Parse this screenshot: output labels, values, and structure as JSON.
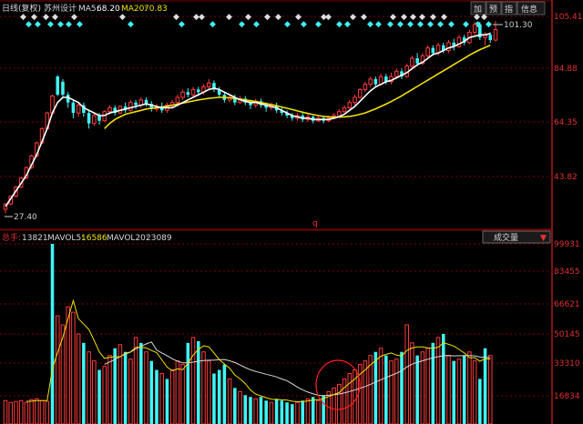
{
  "header": {
    "period": "日线(复权)",
    "stock_name": "苏州设计",
    "ma5_label": "MA5:",
    "ma5_value": "68.20",
    "ma20_label": "MA20:",
    "ma20_value": "70.83",
    "buttons": [
      "加",
      "预",
      "指",
      "信息"
    ]
  },
  "price_axis": {
    "ticks": [
      "105.41",
      "84.88",
      "64.35",
      "43.82"
    ],
    "high_label": "101.30",
    "low_label": "27.40",
    "marker": "q"
  },
  "volume_header": {
    "label": "总手:",
    "value": "13821",
    "mavol5_label": "MAVOL5:",
    "mavol5_value": "16586",
    "mavol20_label": "MAVOL20:",
    "mavol20_value": "23089",
    "indicator": "成交量"
  },
  "volume_axis": {
    "ticks": [
      "99931",
      "83455",
      "66621",
      "50145",
      "33310",
      "16834"
    ]
  },
  "colors": {
    "up": "#ff3b3b",
    "down": "#3ff5f5",
    "ma5": "#ffffff",
    "ma20": "#f0e000",
    "grid": "#7a0000",
    "axis": "#ff2a2a",
    "label_red": "#e03030",
    "circle": "#ff2020"
  },
  "chart_data": {
    "type": "candlestick",
    "title": "苏州设计",
    "price_range": [
      22,
      108
    ],
    "volume_range": [
      0,
      99931
    ],
    "candles": [
      [
        29,
        31,
        27.4,
        31.5,
        "up"
      ],
      [
        31,
        34,
        30.5,
        34.4,
        "up"
      ],
      [
        34,
        37.5,
        33.5,
        38,
        "up"
      ],
      [
        37.5,
        41,
        37,
        41.5,
        "up"
      ],
      [
        41,
        45,
        40.5,
        45.5,
        "up"
      ],
      [
        45,
        49.5,
        44.5,
        50,
        "up"
      ],
      [
        49.5,
        54.5,
        49,
        55,
        "up"
      ],
      [
        54.5,
        60,
        54,
        60.5,
        "up"
      ],
      [
        60,
        66,
        59.5,
        66.5,
        "up"
      ],
      [
        66,
        72.5,
        65.5,
        73,
        "up"
      ],
      [
        73,
        80,
        72.5,
        80.5,
        "down"
      ],
      [
        78,
        73,
        72,
        79,
        "down"
      ],
      [
        73,
        70,
        68,
        74,
        "down"
      ],
      [
        70,
        66,
        64,
        71,
        "down"
      ],
      [
        66,
        69,
        64.5,
        70,
        "up"
      ],
      [
        69,
        66,
        64.5,
        70,
        "down"
      ],
      [
        66,
        62,
        60,
        67,
        "down"
      ],
      [
        62,
        65,
        61,
        66,
        "up"
      ],
      [
        65,
        63,
        61.5,
        66,
        "down"
      ],
      [
        63,
        66.5,
        62.5,
        67,
        "up"
      ],
      [
        66.5,
        68,
        65.5,
        69,
        "up"
      ],
      [
        68,
        66,
        65,
        69,
        "down"
      ],
      [
        66,
        68.5,
        65.5,
        69,
        "up"
      ],
      [
        68.5,
        67,
        66,
        70,
        "down"
      ],
      [
        67,
        70,
        66.5,
        71,
        "up"
      ],
      [
        70,
        69,
        67.5,
        71,
        "down"
      ],
      [
        69,
        71,
        68,
        72,
        "up"
      ],
      [
        71,
        69.5,
        68.5,
        72,
        "down"
      ],
      [
        69.5,
        67.5,
        66.5,
        70.5,
        "down"
      ],
      [
        67.5,
        68.5,
        66.5,
        69.5,
        "up"
      ],
      [
        68.5,
        67,
        66,
        70,
        "down"
      ],
      [
        67,
        69,
        66,
        70,
        "up"
      ],
      [
        69,
        70,
        68,
        71,
        "up"
      ],
      [
        70,
        72,
        69,
        73,
        "up"
      ],
      [
        72,
        74,
        71,
        75,
        "up"
      ],
      [
        74,
        73,
        72,
        75.5,
        "down"
      ],
      [
        73,
        75,
        72,
        76,
        "up"
      ],
      [
        75,
        74,
        72.5,
        76,
        "down"
      ],
      [
        74,
        76,
        73,
        77,
        "up"
      ],
      [
        76,
        77.5,
        75,
        79,
        "up"
      ],
      [
        77.5,
        75,
        74,
        78.5,
        "down"
      ],
      [
        75,
        73,
        72,
        76,
        "down"
      ],
      [
        73,
        71,
        70,
        74,
        "down"
      ],
      [
        71,
        72,
        70,
        73,
        "up"
      ],
      [
        72,
        70,
        69,
        73,
        "down"
      ],
      [
        70,
        71.5,
        69.5,
        72.5,
        "up"
      ],
      [
        71.5,
        70,
        69,
        72.5,
        "down"
      ],
      [
        70,
        69,
        67.5,
        71,
        "down"
      ],
      [
        69,
        70.5,
        68,
        71.5,
        "up"
      ],
      [
        70.5,
        69,
        68,
        71.5,
        "down"
      ],
      [
        69,
        68,
        66.5,
        70,
        "down"
      ],
      [
        68,
        69,
        67,
        70,
        "up"
      ],
      [
        69,
        67,
        66,
        70,
        "down"
      ],
      [
        67,
        66,
        65,
        68,
        "down"
      ],
      [
        66,
        65,
        64,
        67,
        "down"
      ],
      [
        65,
        64,
        63,
        66,
        "down"
      ],
      [
        64,
        65,
        63,
        66,
        "up"
      ],
      [
        65,
        63.5,
        62.5,
        66,
        "down"
      ],
      [
        63.5,
        64.5,
        62.5,
        65.5,
        "up"
      ],
      [
        64.5,
        63,
        62,
        65,
        "down"
      ],
      [
        63,
        64,
        62.5,
        65,
        "up"
      ],
      [
        64,
        63,
        62,
        65,
        "down"
      ],
      [
        63,
        64,
        62.5,
        65,
        "up"
      ],
      [
        64,
        65,
        63.5,
        66,
        "up"
      ],
      [
        65,
        66.5,
        64.5,
        67.5,
        "up"
      ],
      [
        66.5,
        68,
        66,
        69,
        "up"
      ],
      [
        68,
        70,
        67.5,
        71,
        "up"
      ],
      [
        70,
        72,
        69,
        73,
        "up"
      ],
      [
        72,
        75,
        71.5,
        75.5,
        "up"
      ],
      [
        75,
        77,
        74,
        78,
        "up"
      ],
      [
        77,
        79,
        76,
        80,
        "up"
      ],
      [
        79,
        77,
        76,
        80,
        "down"
      ],
      [
        77,
        80,
        76.5,
        81,
        "up"
      ],
      [
        80,
        78,
        77,
        81,
        "down"
      ],
      [
        78,
        80,
        77,
        81.5,
        "up"
      ],
      [
        80,
        82,
        79,
        83,
        "up"
      ],
      [
        82,
        80,
        79,
        83,
        "down"
      ],
      [
        80,
        84,
        79.5,
        85,
        "up"
      ],
      [
        84,
        87,
        83,
        88,
        "up"
      ],
      [
        87,
        85,
        84,
        89,
        "down"
      ],
      [
        85,
        88,
        84.5,
        89,
        "up"
      ],
      [
        88,
        91,
        87,
        92,
        "up"
      ],
      [
        91,
        89,
        88,
        92,
        "down"
      ],
      [
        89,
        92,
        88,
        93,
        "up"
      ],
      [
        92,
        90,
        89,
        93,
        "down"
      ],
      [
        90,
        93,
        89,
        94,
        "up"
      ],
      [
        93,
        91.5,
        90,
        94.5,
        "down"
      ],
      [
        91.5,
        95,
        91,
        96,
        "up"
      ],
      [
        95,
        93,
        92,
        96,
        "down"
      ],
      [
        93,
        97,
        92.5,
        98,
        "up"
      ],
      [
        97,
        100,
        96,
        101,
        "up"
      ],
      [
        100,
        95,
        94,
        101,
        "down"
      ],
      [
        95,
        96,
        92,
        97,
        "up"
      ],
      [
        96,
        94,
        93,
        97,
        "down"
      ],
      [
        94,
        98,
        93.5,
        101.3,
        "up"
      ]
    ],
    "ma5": [
      30,
      33,
      36,
      39,
      42,
      46,
      50,
      55,
      60,
      66,
      70,
      72,
      72,
      71,
      70,
      68,
      67,
      66,
      65,
      65,
      66,
      66.5,
      67,
      67.5,
      68,
      68.5,
      69,
      69.5,
      69,
      68.5,
      68,
      68,
      68,
      69,
      70,
      71,
      72,
      73,
      74,
      75,
      75.5,
      75,
      74,
      73,
      72,
      71,
      70.5,
      70,
      70,
      69.5,
      69,
      68.5,
      68,
      67,
      66,
      65,
      64.5,
      64,
      64,
      63.5,
      63.5,
      63.5,
      63.5,
      64,
      64.5,
      65.5,
      67,
      68.5,
      70.5,
      72.5,
      74.5,
      76,
      77,
      78,
      78.5,
      79.5,
      80.5,
      81.5,
      83,
      84.5,
      85.5,
      87,
      88.5,
      89,
      90,
      91,
      91.5,
      92.5,
      93.5,
      95,
      95.5,
      96,
      96,
      96.5
    ],
    "ma20": [
      null,
      null,
      null,
      null,
      null,
      null,
      null,
      null,
      null,
      null,
      null,
      null,
      null,
      null,
      null,
      null,
      null,
      null,
      null,
      60,
      62,
      63.5,
      64.5,
      65.5,
      66,
      66.5,
      67,
      67.5,
      67.8,
      68,
      68.3,
      68.6,
      69,
      69.4,
      69.8,
      70.2,
      70.6,
      71,
      71.3,
      71.6,
      71.8,
      72,
      72,
      71.8,
      71.6,
      71.3,
      71,
      70.7,
      70.4,
      70,
      69.6,
      69.2,
      68.8,
      68.3,
      67.8,
      67.3,
      66.8,
      66.3,
      65.8,
      65.4,
      65,
      64.7,
      64.5,
      64.4,
      64.4,
      64.5,
      64.7,
      65,
      65.5,
      66,
      66.8,
      67.6,
      68.5,
      69.4,
      70.4,
      71.5,
      72.6,
      73.8,
      75,
      76.2,
      77.4,
      78.6,
      79.8,
      81,
      82.2,
      83.4,
      84.6,
      85.8,
      87,
      88.2,
      89.3,
      90.3,
      91.2,
      92
    ],
    "volumes": [
      13000,
      12000,
      12500,
      13000,
      12000,
      13500,
      14000,
      13000,
      12500,
      99931,
      60000,
      55000,
      65000,
      62000,
      50000,
      45000,
      40000,
      35000,
      30000,
      32000,
      38000,
      42000,
      44000,
      40000,
      36000,
      48000,
      45000,
      40000,
      35000,
      30000,
      28000,
      25000,
      30000,
      35000,
      33000,
      45000,
      48000,
      46000,
      40000,
      35000,
      28000,
      30000,
      33000,
      25000,
      20000,
      18000,
      16000,
      15000,
      14000,
      15000,
      13000,
      12000,
      14000,
      13000,
      12000,
      11000,
      12000,
      13000,
      14000,
      15000,
      13000,
      16000,
      18000,
      20000,
      22000,
      25000,
      28000,
      30000,
      33000,
      35000,
      38000,
      40000,
      42000,
      38000,
      35000,
      36000,
      40000,
      55000,
      45000,
      38000,
      40000,
      42000,
      45000,
      48000,
      50000,
      38000,
      35000,
      36000,
      38000,
      40000,
      35000,
      25000,
      42000,
      38000
    ],
    "volume_colors_up": [
      1,
      1,
      1,
      1,
      1,
      1,
      1,
      1,
      1,
      0,
      1,
      1,
      1,
      1,
      1,
      0,
      1,
      1,
      0,
      1,
      1,
      0,
      1,
      0,
      1,
      1,
      0,
      1,
      0,
      0,
      1,
      0,
      1,
      1,
      1,
      0,
      1,
      0,
      1,
      1,
      0,
      0,
      0,
      1,
      0,
      1,
      0,
      0,
      1,
      0,
      0,
      1,
      0,
      0,
      0,
      0,
      1,
      0,
      1,
      0,
      1,
      0,
      1,
      1,
      1,
      1,
      1,
      1,
      1,
      1,
      1,
      0,
      1,
      0,
      1,
      1,
      0,
      1,
      1,
      0,
      1,
      1,
      0,
      1,
      0,
      1,
      0,
      1,
      0,
      1,
      1,
      0,
      0,
      1
    ],
    "mavol5": [
      null,
      null,
      null,
      null,
      12600,
      12600,
      13000,
      13000,
      13000,
      30500,
      39700,
      48100,
      58500,
      68500,
      58400,
      55400,
      52400,
      46400,
      40000,
      36400,
      37000,
      37400,
      37200,
      39200,
      40000,
      42600,
      42600,
      42200,
      40800,
      39600,
      35600,
      31600,
      29600,
      30600,
      30200,
      33600,
      38200,
      41400,
      43400,
      42800,
      39400,
      35800,
      33200,
      31000,
      27200,
      25000,
      22400,
      18800,
      16600,
      15600,
      14600,
      13800,
      13600,
      13400,
      13200,
      12600,
      12400,
      12400,
      12800,
      13200,
      13400,
      14200,
      15200,
      16400,
      17400,
      20200,
      22600,
      25000,
      27600,
      30000,
      32800,
      35200,
      37600,
      38600,
      39400,
      38200,
      37800,
      40800,
      42200,
      42800,
      42800,
      42200,
      42000,
      42600,
      45000,
      44200,
      43200,
      41400,
      39400,
      36800,
      36800,
      34800,
      36200,
      36000
    ],
    "mavol20": [
      null,
      null,
      null,
      null,
      null,
      null,
      null,
      null,
      null,
      null,
      null,
      null,
      null,
      null,
      null,
      null,
      null,
      null,
      null,
      33000,
      34400,
      35900,
      37400,
      38700,
      39900,
      41600,
      43100,
      44400,
      45500,
      41000,
      39400,
      37900,
      36200,
      34800,
      33900,
      33900,
      34300,
      34800,
      35200,
      35400,
      35400,
      35700,
      35800,
      35100,
      34100,
      32700,
      31300,
      30100,
      29100,
      28400,
      27600,
      26900,
      26100,
      25000,
      24000,
      22300,
      20500,
      19000,
      17700,
      16700,
      15950,
      15700,
      15950,
      16200,
      16650,
      17200,
      18000,
      18850,
      19850,
      20800,
      22000,
      23300,
      24550,
      25800,
      26950,
      28150,
      29550,
      31650,
      33200,
      34250,
      35100,
      35950,
      36700,
      37350,
      37900,
      37950,
      37800,
      37850,
      37950,
      38000,
      37800,
      37150,
      37050,
      36850
    ]
  }
}
